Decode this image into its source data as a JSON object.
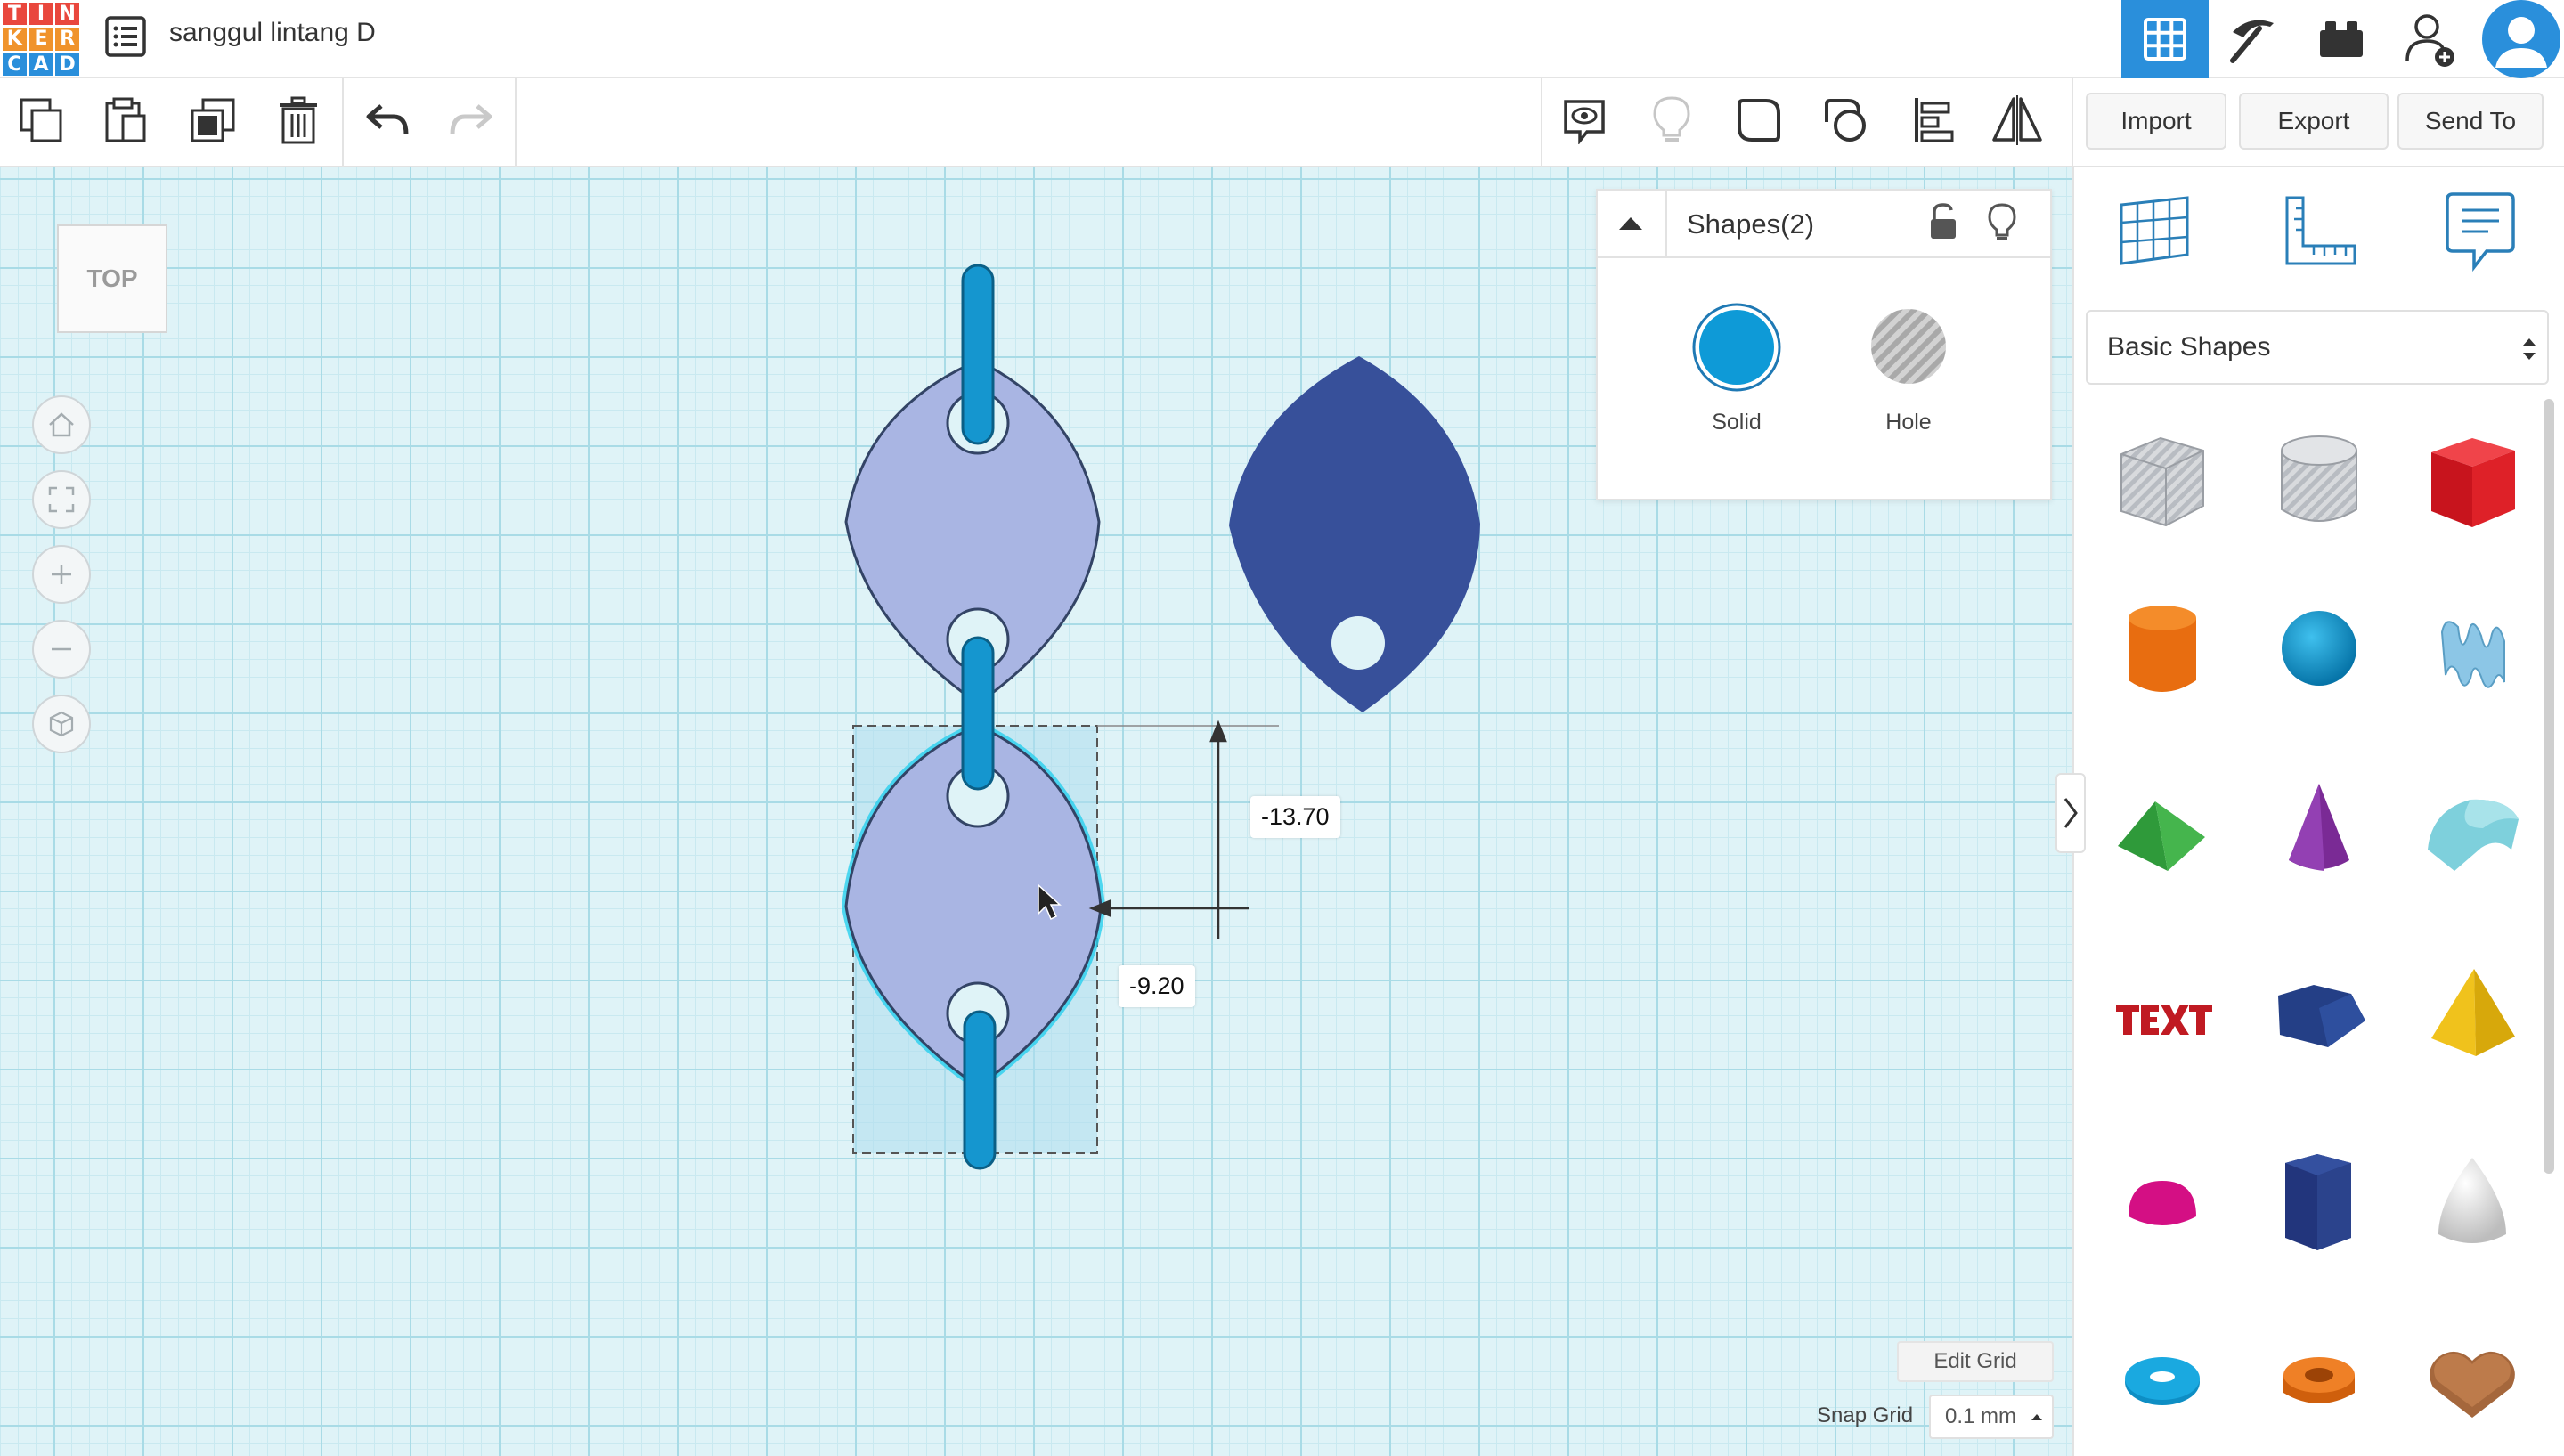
{
  "app": {
    "logo_letters": [
      "T",
      "I",
      "N",
      "K",
      "E",
      "R",
      "C",
      "A",
      "D"
    ],
    "logo_colors": [
      "#e9473d",
      "#e9473d",
      "#e9473d",
      "#f0932b",
      "#f0932b",
      "#f0932b",
      "#2a8fdb",
      "#2a8fdb",
      "#2a8fdb"
    ],
    "doc_title": "sanggul lintang D"
  },
  "header": {
    "icons": [
      "grid-view-icon",
      "pickaxe-icon",
      "brick-icon",
      "add-user-icon",
      "avatar-icon"
    ],
    "accent": "#2a8fdb"
  },
  "toolbar": {
    "left_icons": [
      "copy-icon",
      "paste-icon",
      "duplicate-icon",
      "delete-icon",
      "undo-icon",
      "redo-icon"
    ],
    "right_icons": [
      "note-icon",
      "light-bulb-icon",
      "group-icon",
      "ungroup-icon",
      "align-icon",
      "mirror-icon"
    ],
    "import_label": "Import",
    "export_label": "Export",
    "send_to_label": "Send To"
  },
  "viewcube": {
    "label": "TOP"
  },
  "nav": [
    "home-view-icon",
    "fit-view-icon",
    "zoom-in-icon",
    "zoom-out-icon",
    "perspective-icon"
  ],
  "dimensions": {
    "vertical": "-13.70",
    "horizontal": "-9.20"
  },
  "inspector": {
    "title": "Shapes(2)",
    "solid_label": "Solid",
    "hole_label": "Hole",
    "solid_color": "#0e9ad7"
  },
  "panel": {
    "tools": [
      "workplane-icon",
      "ruler-icon",
      "notes-icon"
    ],
    "category": "Basic Shapes",
    "shapes": [
      "box-hole",
      "cylinder-hole",
      "box",
      "cylinder",
      "sphere",
      "scribble",
      "roof",
      "cone",
      "round-roof",
      "text",
      "wedge",
      "pyramid",
      "half-sphere",
      "polygon",
      "paraboloid",
      "torus",
      "tube",
      "heart"
    ]
  },
  "grid": {
    "edit_grid_label": "Edit Grid",
    "snap_label": "Snap Grid",
    "snap_value": "0.1 mm"
  },
  "scene_colors": {
    "light_shape": "#a9b5e3",
    "dark_shape": "#37509a",
    "link": "#1596cf"
  }
}
